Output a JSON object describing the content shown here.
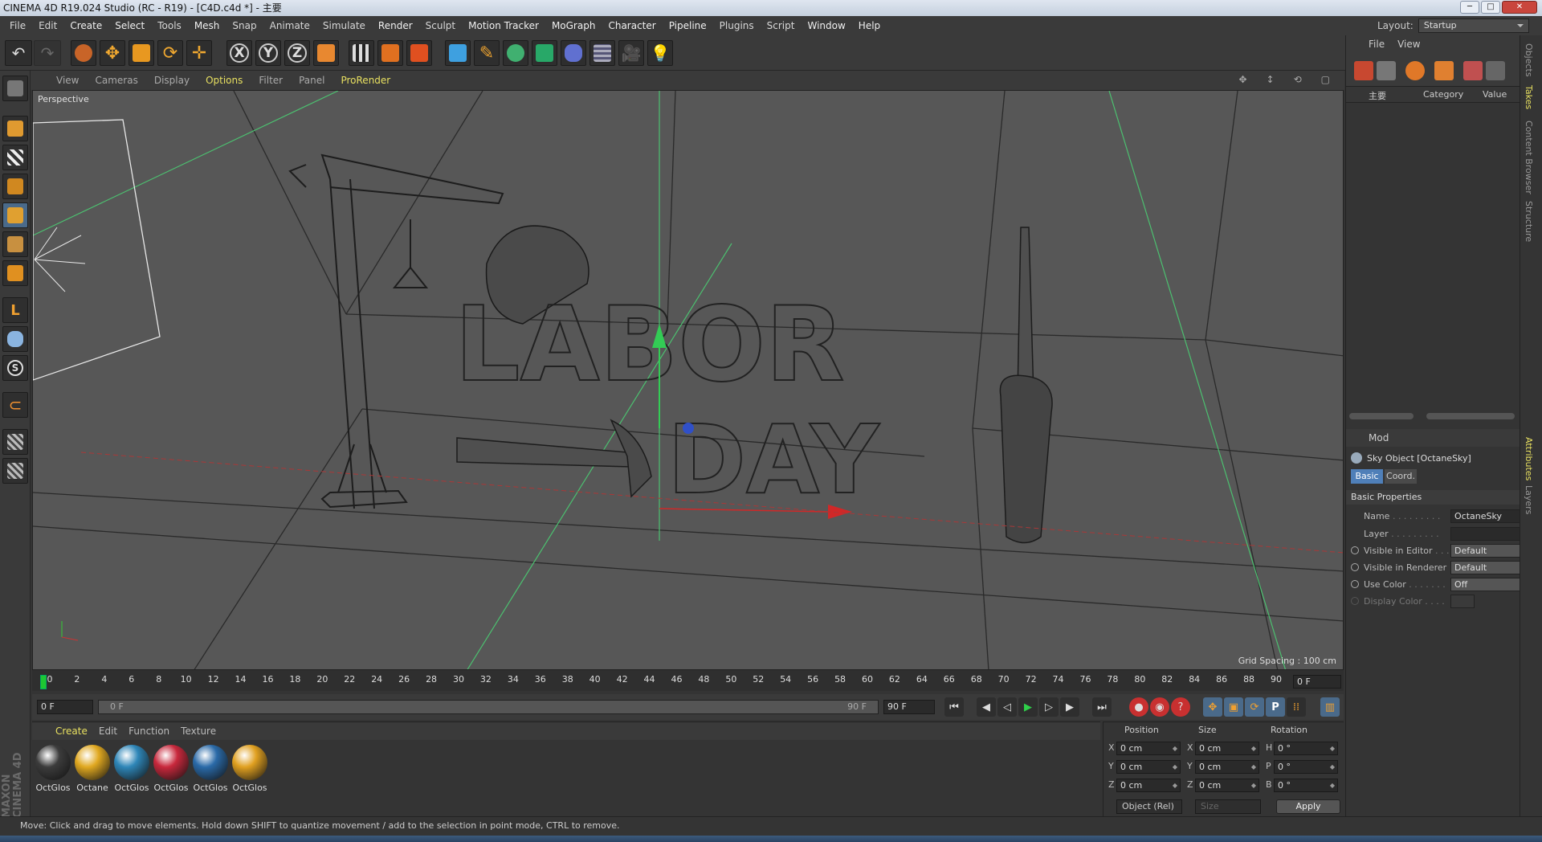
{
  "window": {
    "title": "CINEMA 4D R19.024 Studio (RC - R19) - [C4D.c4d *] - 主要"
  },
  "menu": [
    "File",
    "Edit",
    "Create",
    "Select",
    "Tools",
    "Mesh",
    "Snap",
    "Animate",
    "Simulate",
    "Render",
    "Sculpt",
    "Motion Tracker",
    "MoGraph",
    "Character",
    "Pipeline",
    "Plugins",
    "Script",
    "Window",
    "Help"
  ],
  "layout": {
    "label": "Layout:",
    "value": "Startup"
  },
  "viewport": {
    "menu": [
      "View",
      "Cameras",
      "Display",
      "Options",
      "Filter",
      "Panel",
      "ProRender"
    ],
    "camera_label": "Perspective",
    "grid_spacing": "Grid Spacing : 100 cm",
    "scene_text_line1": "LABOR",
    "scene_text_line2": "DAY"
  },
  "timeline": {
    "ticks": [
      "0",
      "2",
      "4",
      "6",
      "8",
      "10",
      "12",
      "14",
      "16",
      "18",
      "20",
      "22",
      "24",
      "26",
      "28",
      "30",
      "32",
      "34",
      "36",
      "38",
      "40",
      "42",
      "44",
      "46",
      "48",
      "50",
      "52",
      "54",
      "56",
      "58",
      "60",
      "62",
      "64",
      "66",
      "68",
      "70",
      "72",
      "74",
      "76",
      "78",
      "80",
      "82",
      "84",
      "86",
      "88",
      "90"
    ],
    "current_frame": "0 F"
  },
  "transport": {
    "start": "0 F",
    "slider_start": "0 F",
    "slider_end": "90 F",
    "end": "90 F"
  },
  "material_manager": {
    "menu": [
      "Create",
      "Edit",
      "Function",
      "Texture"
    ],
    "materials": [
      {
        "label": "OctGlos",
        "color": "#3c3c3c"
      },
      {
        "label": "Octane",
        "color": "#e0a820"
      },
      {
        "label": "OctGlos",
        "color": "#2e86b8"
      },
      {
        "label": "OctGlos",
        "color": "#c8283c"
      },
      {
        "label": "OctGlos",
        "color": "#2a6aa8"
      },
      {
        "label": "OctGlos",
        "color": "#e0a020"
      }
    ]
  },
  "coordinates": {
    "headers": [
      "Position",
      "Size",
      "Rotation"
    ],
    "rows": [
      {
        "axis": "X",
        "pos": "0 cm",
        "saxis": "X",
        "size": "0 cm",
        "raxis": "H",
        "rot": "0 °"
      },
      {
        "axis": "Y",
        "pos": "0 cm",
        "saxis": "Y",
        "size": "0 cm",
        "raxis": "P",
        "rot": "0 °"
      },
      {
        "axis": "Z",
        "pos": "0 cm",
        "saxis": "Z",
        "size": "0 cm",
        "raxis": "B",
        "rot": "0 °"
      }
    ],
    "mode": "Object (Rel)",
    "size_mode": "Size",
    "apply": "Apply"
  },
  "status": "Move: Click and drag to move elements. Hold down SHIFT to quantize movement / add to the selection in point mode, CTRL to remove.",
  "object_manager": {
    "menu": [
      "File",
      "View"
    ],
    "col_name": "主要",
    "col_category": "Category",
    "col_value": "Value"
  },
  "attribute_manager": {
    "menu": "Mod",
    "object_title": "Sky Object [OctaneSky]",
    "tabs": [
      "Basic",
      "Coord."
    ],
    "section": "Basic Properties",
    "props": [
      {
        "label": "Name",
        "value": "OctaneSky"
      },
      {
        "label": "Layer",
        "value": ""
      },
      {
        "label": "Visible in Editor",
        "value": "Default"
      },
      {
        "label": "Visible in Renderer",
        "value": "Default"
      },
      {
        "label": "Use Color",
        "value": "Off"
      },
      {
        "label": "Display Color",
        "value": ""
      }
    ]
  },
  "side_tabs": [
    "Objects",
    "Takes",
    "Content Browser",
    "Structure",
    "Attributes",
    "Layers"
  ],
  "logo": "MAXON CINEMA 4D"
}
